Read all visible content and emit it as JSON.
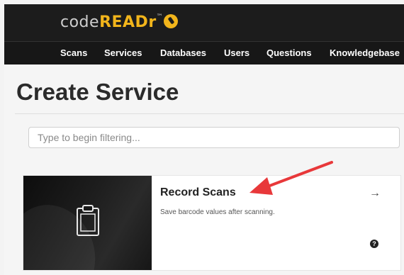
{
  "brand": {
    "prefix": "code",
    "highlight": "READr",
    "tm": "™",
    "accent": "#f2b51b"
  },
  "nav": {
    "items": [
      {
        "label": "Scans"
      },
      {
        "label": "Services"
      },
      {
        "label": "Databases"
      },
      {
        "label": "Users"
      },
      {
        "label": "Questions"
      },
      {
        "label": "Knowledgebase"
      }
    ]
  },
  "page": {
    "title": "Create Service"
  },
  "filter": {
    "placeholder": "Type to begin filtering..."
  },
  "service_card": {
    "title": "Record Scans",
    "description": "Save barcode values after scanning.",
    "arrow_icon": "→",
    "help_icon": "?",
    "image_icon": "clipboard-icon"
  },
  "annotation": {
    "arrow_color": "#e8383a"
  }
}
